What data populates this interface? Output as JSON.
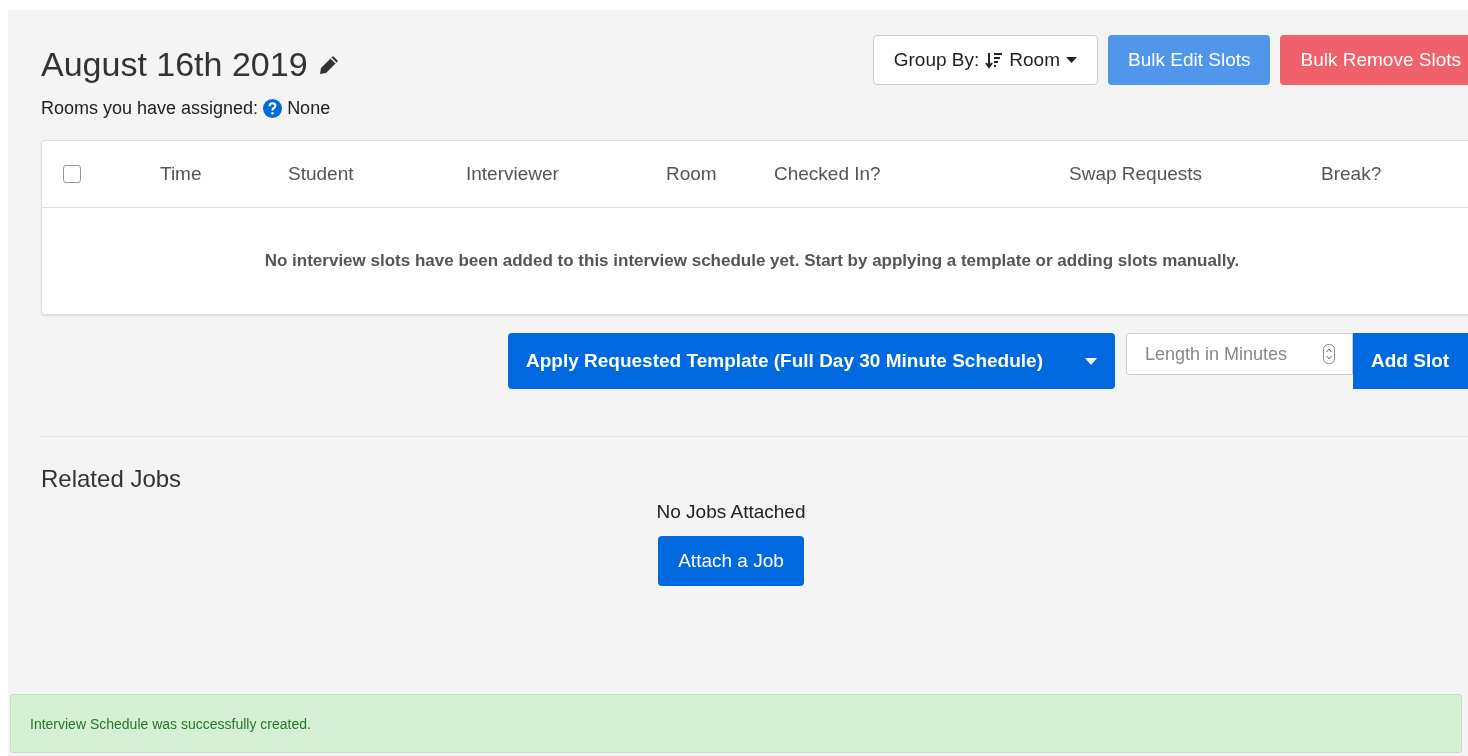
{
  "header": {
    "title": "August 16th 2019",
    "rooms_label": "Rooms you have assigned:",
    "rooms_value": "None"
  },
  "toolbar": {
    "group_by": {
      "label": "Group By:",
      "value": "Room"
    },
    "buttons": [
      {
        "label": "Bulk Edit Slots",
        "kind": "primary"
      },
      {
        "label": "Bulk Remove Slots",
        "kind": "danger"
      }
    ]
  },
  "table": {
    "select_all": {
      "checked": false
    },
    "columns": [
      "Time",
      "Student",
      "Interviewer",
      "Room",
      "Checked In?",
      "Swap Requests",
      "Break?"
    ],
    "empty_message": "No interview slots have been added to this interview schedule yet. Start by applying a template or adding slots manually."
  },
  "slot_actions": {
    "template_button": "Apply Requested Template (Full Day 30 Minute Schedule)",
    "length_field": {
      "placeholder": "Length in Minutes"
    },
    "add_button": "Add Slot"
  },
  "related_jobs": {
    "heading": "Related Jobs",
    "empty_message": "No Jobs Attached",
    "attach_button": "Attach a Job"
  },
  "alert": {
    "message": "Interview Schedule was successfully created."
  }
}
